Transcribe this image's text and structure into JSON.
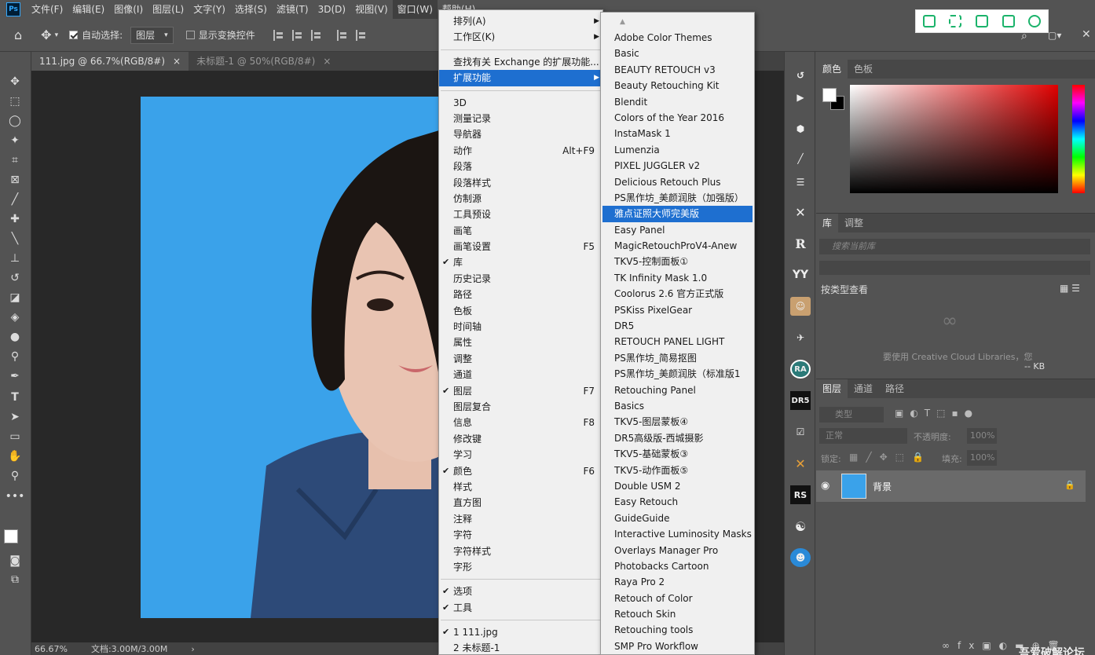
{
  "app": {
    "logo": "Ps"
  },
  "menubar": {
    "items": [
      "文件(F)",
      "编辑(E)",
      "图像(I)",
      "图层(L)",
      "文字(Y)",
      "选择(S)",
      "滤镜(T)",
      "3D(D)",
      "视图(V)",
      "窗口(W)",
      "帮助(H)"
    ]
  },
  "options": {
    "auto_select_label": "自动选择:",
    "auto_select_value": "图层",
    "show_transform_label": "显示变换控件"
  },
  "tabs": [
    {
      "label": "111.jpg @ 66.7%(RGB/8#)",
      "close": "×"
    },
    {
      "label": "未标题-1 @ 50%(RGB/8#)",
      "close": "×"
    }
  ],
  "status": {
    "zoom": "66.67%",
    "doc": "文档:3.00M/3.00M"
  },
  "window_menu": {
    "group1": [
      {
        "label": "排列(A)",
        "submenu": true
      },
      {
        "label": "工作区(K)",
        "submenu": true
      }
    ],
    "group2": [
      {
        "label": "查找有关 Exchange 的扩展功能..."
      },
      {
        "label": "扩展功能",
        "submenu": true,
        "highlight": true
      }
    ],
    "group3": [
      {
        "label": "3D"
      },
      {
        "label": "测量记录"
      },
      {
        "label": "导航器"
      },
      {
        "label": "动作",
        "shortcut": "Alt+F9"
      },
      {
        "label": "段落"
      },
      {
        "label": "段落样式"
      },
      {
        "label": "仿制源"
      },
      {
        "label": "工具预设"
      },
      {
        "label": "画笔"
      },
      {
        "label": "画笔设置",
        "shortcut": "F5"
      },
      {
        "label": "库",
        "checked": true
      },
      {
        "label": "历史记录"
      },
      {
        "label": "路径"
      },
      {
        "label": "色板"
      },
      {
        "label": "时间轴"
      },
      {
        "label": "属性"
      },
      {
        "label": "调整"
      },
      {
        "label": "通道"
      },
      {
        "label": "图层",
        "shortcut": "F7",
        "checked": true
      },
      {
        "label": "图层复合"
      },
      {
        "label": "信息",
        "shortcut": "F8"
      },
      {
        "label": "修改键"
      },
      {
        "label": "学习"
      },
      {
        "label": "颜色",
        "shortcut": "F6",
        "checked": true
      },
      {
        "label": "样式"
      },
      {
        "label": "直方图"
      },
      {
        "label": "注释"
      },
      {
        "label": "字符"
      },
      {
        "label": "字符样式"
      },
      {
        "label": "字形"
      }
    ],
    "group4": [
      {
        "label": "选项",
        "checked": true
      },
      {
        "label": "工具",
        "checked": true
      }
    ],
    "group5": [
      {
        "label": "1 111.jpg",
        "checked": true
      },
      {
        "label": "2 未标题-1"
      }
    ]
  },
  "extensions_menu": {
    "items": [
      "Adobe Color Themes",
      "Basic",
      "BEAUTY RETOUCH v3",
      "Beauty Retouching Kit",
      "Blendit",
      "Colors of the Year 2016",
      "InstaMask 1",
      "Lumenzia",
      "PIXEL JUGGLER v2",
      "Delicious Retouch Plus",
      "PS黑作坊_美颜润肤（加强版）",
      "雅点证照大师完美版",
      "Easy Panel",
      "MagicRetouchProV4-Anew",
      "TKV5-控制面板①",
      "TK Infinity Mask 1.0",
      "Coolorus 2.6 官方正式版",
      "PSKiss PixelGear",
      "DR5",
      "RETOUCH PANEL LIGHT",
      "PS黑作坊_简易抠图",
      "PS黑作坊_美颜润肤（标准版1",
      "Retouching Panel",
      "Basics",
      "TKV5-图层蒙板④",
      "DR5高级版-西城摄影",
      "TKV5-基础蒙板③",
      "TKV5-动作面板⑤",
      "Double USM 2",
      "Easy Retouch",
      "GuideGuide",
      "Interactive Luminosity Masks",
      "Overlays Manager Pro",
      "Photobacks Cartoon",
      "Raya Pro 2",
      "Retouch of Color",
      "Retouch Skin",
      "Retouching tools",
      "SMP Pro Workflow"
    ],
    "highlight_index": 11
  },
  "color_panel": {
    "tabs": [
      "颜色",
      "色板"
    ]
  },
  "library_panel": {
    "tabs": [
      "库",
      "调整"
    ],
    "search_placeholder": "搜索当前库",
    "view_label": "按类型查看",
    "cc_text": "要使用 Creative Cloud Libraries，您",
    "size": "-- KB"
  },
  "layers_panel": {
    "tabs": [
      "图层",
      "通道",
      "路径"
    ],
    "kind": "类型",
    "blend": "正常",
    "opacity_label": "不透明度:",
    "opacity_value": "100%",
    "lock_label": "锁定:",
    "fill_label": "填充:",
    "fill_value": "100%",
    "layer_name": "背景"
  },
  "icon_strip": [
    "RA",
    "DR5",
    "RS",
    "R",
    "YY"
  ],
  "watermark": "吾爱破解论坛"
}
